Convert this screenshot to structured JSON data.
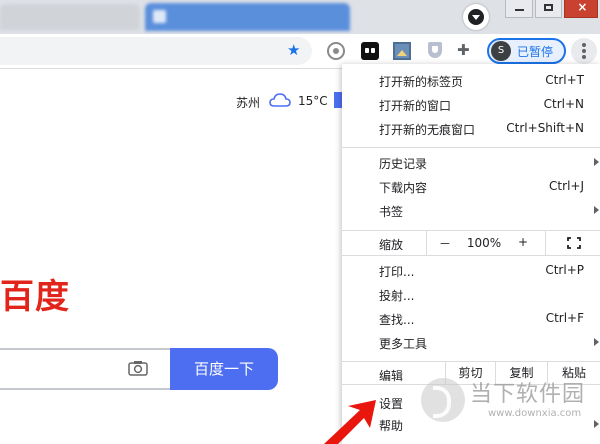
{
  "browser": {
    "profile_status": "已暂停",
    "profile_initial": "S"
  },
  "page": {
    "weather_city": "苏州",
    "weather_temp": "15°C",
    "logo_text": "百度",
    "search_button_label": "百度一下"
  },
  "menu": {
    "items": [
      {
        "label": "打开新的标签页",
        "shortcut": "Ctrl+T"
      },
      {
        "label": "打开新的窗口",
        "shortcut": "Ctrl+N"
      },
      {
        "label": "打开新的无痕窗口",
        "shortcut": "Ctrl+Shift+N"
      },
      {
        "label": "历史记录"
      },
      {
        "label": "下载内容",
        "shortcut": "Ctrl+J"
      },
      {
        "label": "书签"
      },
      {
        "label": "打印...",
        "shortcut": "Ctrl+P"
      },
      {
        "label": "投射..."
      },
      {
        "label": "查找...",
        "shortcut": "Ctrl+F"
      },
      {
        "label": "更多工具"
      },
      {
        "label": "设置"
      },
      {
        "label": "帮助"
      }
    ],
    "zoom": {
      "label": "缩放",
      "minus": "－",
      "value": "100%",
      "plus": "+"
    },
    "edit": {
      "label": "编辑",
      "cut": "剪切",
      "copy": "复制",
      "paste": "粘贴"
    }
  },
  "watermark": {
    "title": "当下软件园",
    "url": "www.downxia.com"
  },
  "colors": {
    "accent": "#1a73e8",
    "baidu_blue": "#4e6ef2",
    "baidu_red": "#e1251b"
  }
}
